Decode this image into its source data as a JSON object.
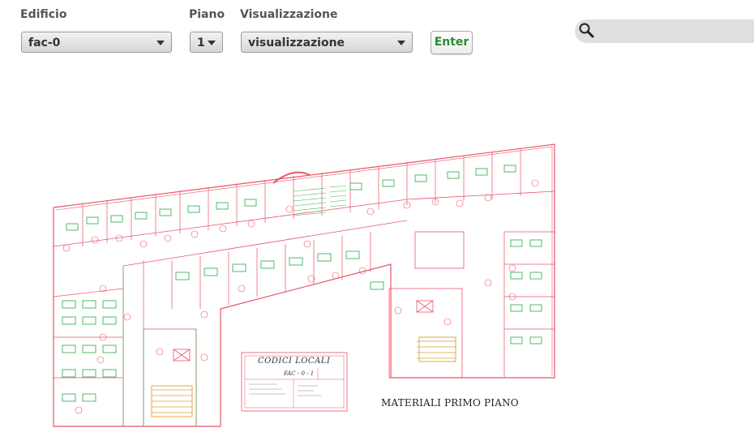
{
  "filters": {
    "edificio": {
      "label": "Edificio",
      "value": "fac-0"
    },
    "piano": {
      "label": "Piano",
      "value": "1"
    },
    "visualizzazione": {
      "label": "Visualizzazione",
      "value": "visualizzazione"
    },
    "enter_label": "Enter"
  },
  "search": {
    "placeholder": "",
    "icon": "search-icon"
  },
  "floorplan": {
    "title": "MATERIALI PRIMO PIANO",
    "cartouche": {
      "heading": "CODICI LOCALI",
      "code": "FAC - 0 - 1"
    }
  },
  "colors": {
    "walls": "#e8556a",
    "furniture": "#3cb45a",
    "accent_green": "#2e8b2e"
  }
}
